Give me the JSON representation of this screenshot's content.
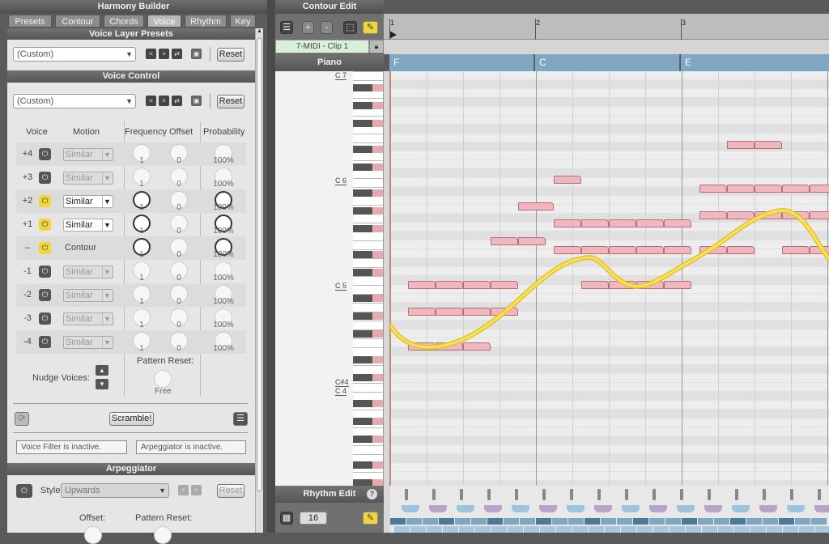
{
  "app": {
    "title": "Harmony Builder"
  },
  "tabs": [
    {
      "label": "Presets",
      "active": false
    },
    {
      "label": "Contour",
      "active": false
    },
    {
      "label": "Chords",
      "active": false
    },
    {
      "label": "Voice",
      "active": true
    },
    {
      "label": "Rhythm",
      "active": false
    },
    {
      "label": "Key",
      "active": false
    }
  ],
  "voice_layer": {
    "title": "Voice Layer Presets",
    "preset": "(Custom)",
    "reset": "Reset"
  },
  "voice_control": {
    "title": "Voice Control",
    "preset": "(Custom)",
    "reset": "Reset",
    "headers": {
      "voice": "Voice",
      "motion": "Motion",
      "frequency": "Frequency",
      "offset": "Offset",
      "probability": "Probability"
    },
    "rows": [
      {
        "voice": "+4",
        "on": false,
        "motion": "Similar",
        "freq": "1",
        "offset": "0",
        "prob": "100%"
      },
      {
        "voice": "+3",
        "on": false,
        "motion": "Similar",
        "freq": "1",
        "offset": "0",
        "prob": "100%"
      },
      {
        "voice": "+2",
        "on": true,
        "motion": "Similar",
        "freq": "1",
        "offset": "0",
        "prob": "100%"
      },
      {
        "voice": "+1",
        "on": true,
        "motion": "Similar",
        "freq": "1",
        "offset": "0",
        "prob": "100%"
      },
      {
        "voice": "–",
        "on": true,
        "motion": "Contour",
        "freq": "1",
        "offset": "0",
        "prob": "100%"
      },
      {
        "voice": "-1",
        "on": false,
        "motion": "Similar",
        "freq": "1",
        "offset": "0",
        "prob": "100%"
      },
      {
        "voice": "-2",
        "on": false,
        "motion": "Similar",
        "freq": "1",
        "offset": "0",
        "prob": "100%"
      },
      {
        "voice": "-3",
        "on": false,
        "motion": "Similar",
        "freq": "1",
        "offset": "0",
        "prob": "100%"
      },
      {
        "voice": "-4",
        "on": false,
        "motion": "Similar",
        "freq": "1",
        "offset": "0",
        "prob": "100%"
      }
    ],
    "nudge_label": "Nudge Voices:",
    "pattern_reset_label": "Pattern Reset:",
    "pattern_reset_value": "Free",
    "scramble": "Scramble!",
    "voice_filter_status": "Voice Filter is inactive.",
    "arpeggiator_status": "Arpeggiator is inactive."
  },
  "arpeggiator": {
    "title": "Arpeggiator",
    "style_label": "Style:",
    "style": "Upwards",
    "reset": "Reset",
    "offset_label": "Offset:",
    "pattern_reset_label": "Pattern Reset:"
  },
  "contour_edit": {
    "title": "Contour Edit",
    "clip_name": "7-MIDI - Clip 1",
    "piano_label": "Piano"
  },
  "ruler": {
    "bars": [
      "1",
      "2",
      "3"
    ]
  },
  "chords": [
    "F",
    "C",
    "E"
  ],
  "keyboard_labels": {
    "c7": "C 7",
    "c6": "C 6",
    "c5": "C 5",
    "cs4": "C#4",
    "c4": "C 4"
  },
  "rhythm_edit": {
    "title": "Rhythm Edit",
    "steps": "16"
  },
  "colors": {
    "accent": "#f0d63a",
    "note": "#f0b8be",
    "chord_bar": "#7fa6c2",
    "contour": "#f3d33a"
  }
}
